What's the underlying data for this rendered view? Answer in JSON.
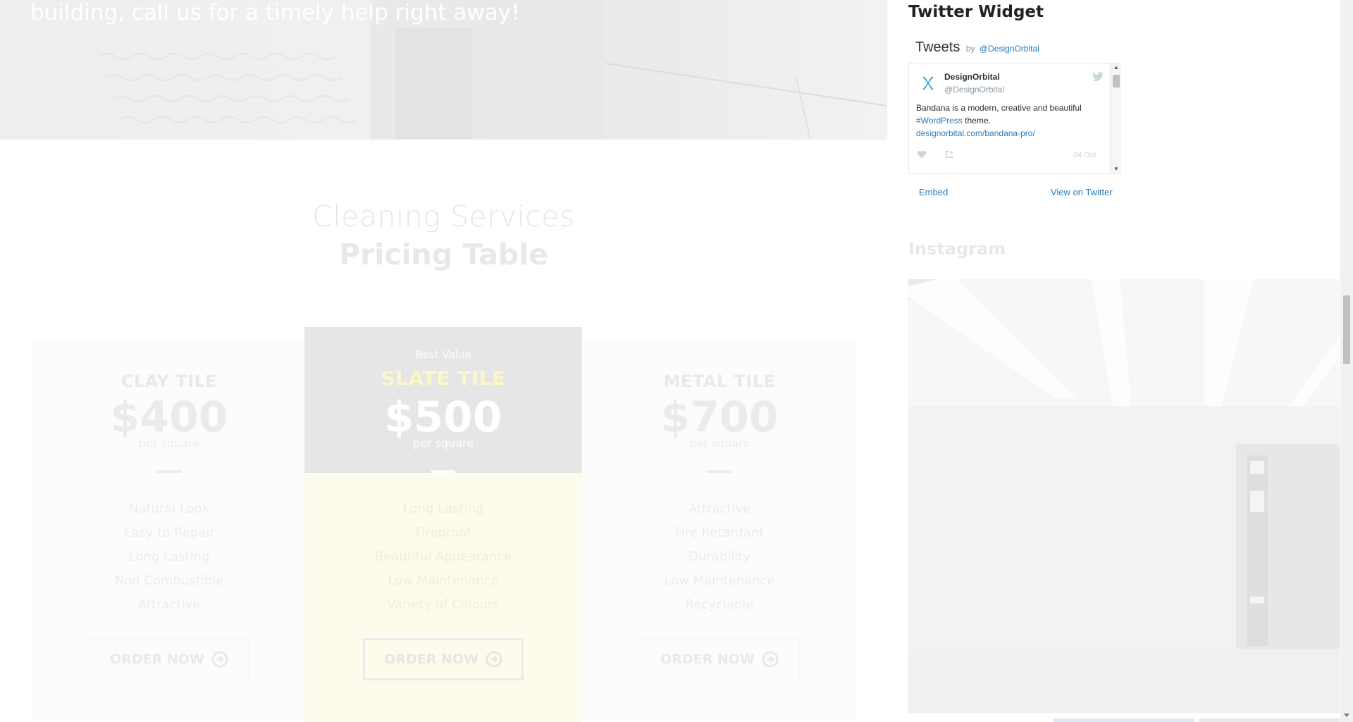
{
  "hero": {
    "text": "building, call us for a timely help right away!"
  },
  "pricing": {
    "subtitle": "Cleaning Services",
    "title": "Pricing Table",
    "plans": [
      {
        "name": "CLAY TILE",
        "price": "$400",
        "unit": "per square",
        "features": [
          "Natural Look",
          "Easy to Repair",
          "Long Lasting",
          "Non Combustible",
          "Attractive"
        ],
        "button": "ORDER NOW"
      },
      {
        "badge": "Best Value",
        "name": "SLATE TILE",
        "price": "$500",
        "unit": "per square",
        "features": [
          "Long Lasting",
          "Fireproof",
          "Beautiful Appearance",
          "Low Maintenance",
          "Variety of Colours"
        ],
        "button": "ORDER NOW"
      },
      {
        "name": "METAL TILE",
        "price": "$700",
        "unit": "per square",
        "features": [
          "Attractive",
          "Fire Retardant",
          "Durability",
          "Low Maintenance",
          "Recyclable"
        ],
        "button": "ORDER NOW"
      }
    ]
  },
  "sidebar": {
    "twitter": {
      "title": "Twitter Widget",
      "tweets_label": "Tweets",
      "by": "by",
      "handle": "@DesignOrbital",
      "tweet": {
        "author": "DesignOrbital",
        "author_handle": "@DesignOrbital",
        "text_before": "Bandana is a modern, creative and beautiful",
        "hashtag": "#WordPress",
        "text_after": "theme.",
        "link": "designorbital.com/bandana-pro/",
        "date": "04 Oct"
      },
      "embed": "Embed",
      "view_on_twitter": "View on Twitter"
    },
    "instagram": {
      "title": "Instagram"
    }
  },
  "colors": {
    "twitter_link": "#2b7bb9",
    "highlight_panel": "#fdfbec",
    "featured_header": "#e6e6e6"
  },
  "icons": {
    "order": "arrow-circle-right-icon",
    "like": "heart-icon",
    "share": "share-icon",
    "bird": "twitter-bird-icon",
    "avatar": "designorbital-logo-icon"
  }
}
